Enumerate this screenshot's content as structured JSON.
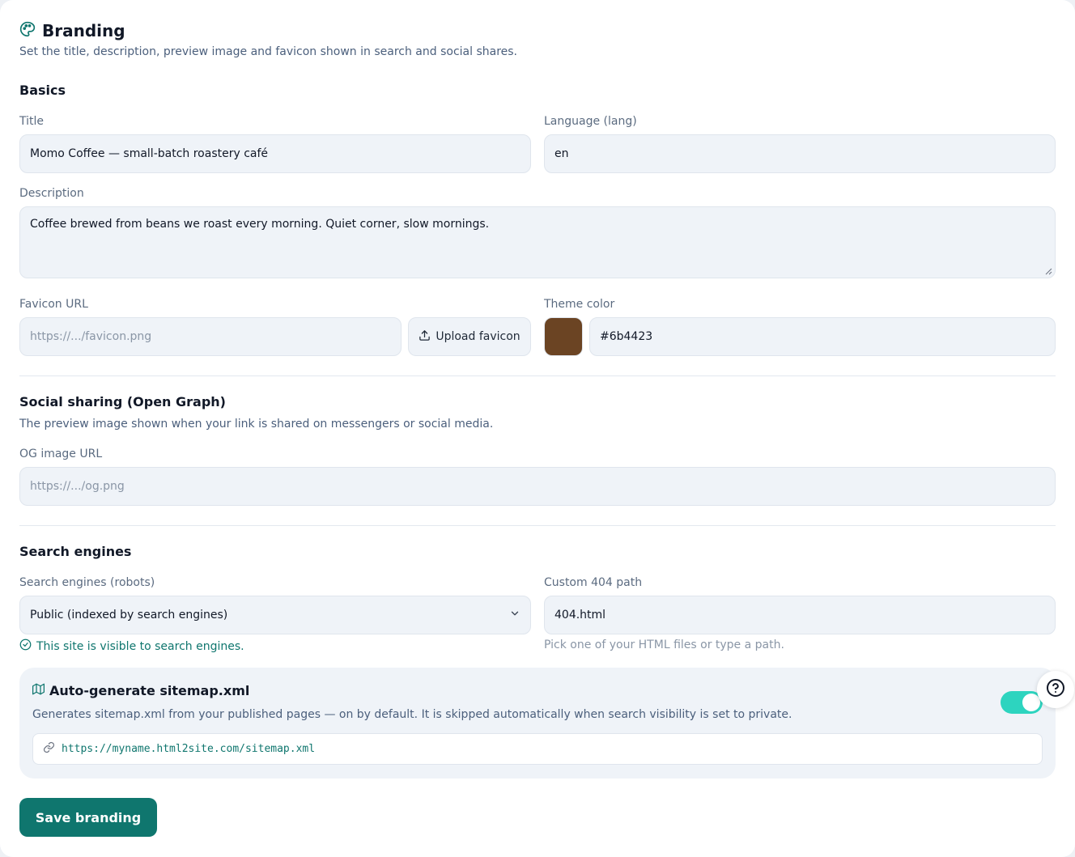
{
  "header": {
    "title": "Branding",
    "subtitle": "Set the title, description, preview image and favicon shown in search and social shares."
  },
  "basics": {
    "heading": "Basics",
    "title_label": "Title",
    "title_value": "Momo Coffee — small-batch roastery café",
    "lang_label": "Language (lang)",
    "lang_value": "en",
    "description_label": "Description",
    "description_value": "Coffee brewed from beans we roast every morning. Quiet corner, slow mornings.",
    "favicon_label": "Favicon URL",
    "favicon_placeholder": "https://.../favicon.png",
    "upload_label": "Upload favicon",
    "theme_label": "Theme color",
    "theme_value": "#6b4423"
  },
  "social": {
    "heading": "Social sharing (Open Graph)",
    "description": "The preview image shown when your link is shared on messengers or social media.",
    "og_label": "OG image URL",
    "og_placeholder": "https://.../og.png"
  },
  "search": {
    "heading": "Search engines",
    "robots_label": "Search engines (robots)",
    "robots_value": "Public (indexed by search engines)",
    "robots_hint": "This site is visible to search engines.",
    "notfound_label": "Custom 404 path",
    "notfound_value": "404.html",
    "notfound_hint": "Pick one of your HTML files or type a path."
  },
  "sitemap": {
    "title": "Auto-generate sitemap.xml",
    "description": "Generates sitemap.xml from your published pages — on by default. It is skipped automatically when search visibility is set to private.",
    "url": "https://myname.html2site.com/sitemap.xml",
    "enabled": true
  },
  "actions": {
    "save_label": "Save branding"
  },
  "colors": {
    "accent": "#0f766e",
    "toggle_on": "#2dd4bf",
    "theme_swatch": "#6b4423"
  },
  "icons": {
    "header": "palette-icon",
    "upload": "upload-icon",
    "select": "chevron-down-icon",
    "ok": "check-circle-icon",
    "sitemap": "map-icon",
    "link": "link-icon",
    "help": "question-circle-icon"
  }
}
